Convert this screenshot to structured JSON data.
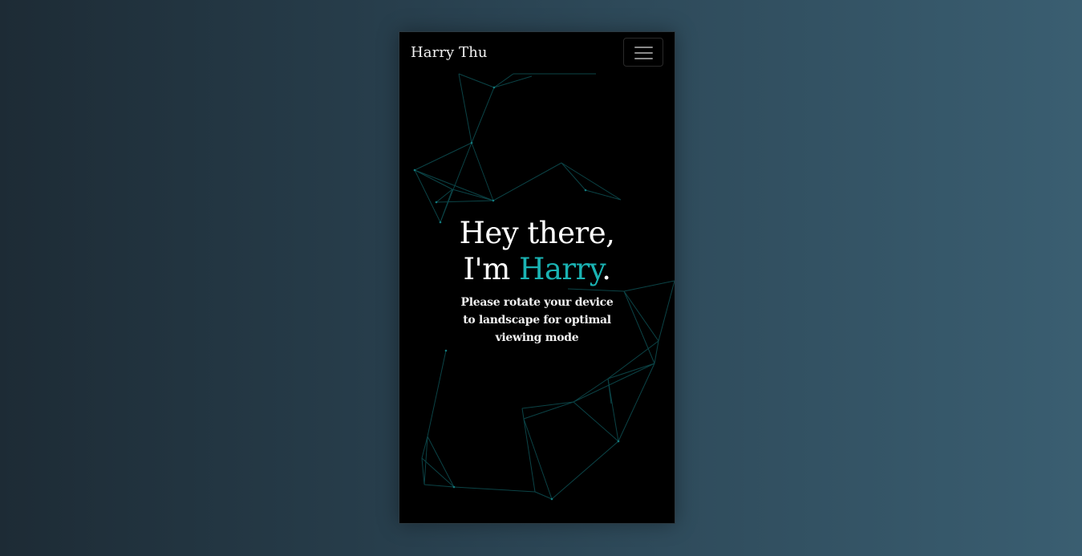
{
  "brand": "Harry Thu",
  "menu_icon": "hamburger-menu-icon",
  "hero": {
    "line1": "Hey there,",
    "line2_prefix": "I'm ",
    "name": "Harry",
    "line2_suffix": ".",
    "subtitle": "Please rotate your device to landscape for optimal viewing mode"
  },
  "colors": {
    "accent": "#1ab3b3",
    "background_left": "#1d2b35",
    "background_right": "#3a5e71",
    "device_bg": "#000000",
    "network_lines": "#0f5a5e"
  }
}
